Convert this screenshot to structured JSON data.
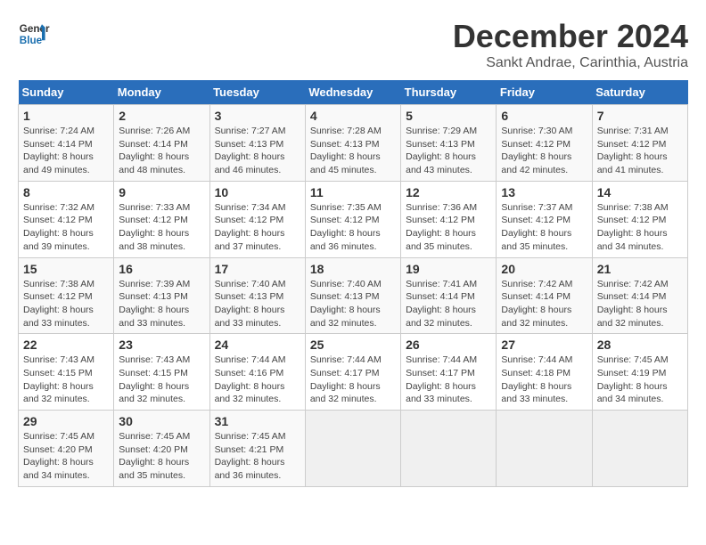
{
  "header": {
    "logo_line1": "General",
    "logo_line2": "Blue",
    "main_title": "December 2024",
    "subtitle": "Sankt Andrae, Carinthia, Austria"
  },
  "calendar": {
    "weekdays": [
      "Sunday",
      "Monday",
      "Tuesday",
      "Wednesday",
      "Thursday",
      "Friday",
      "Saturday"
    ],
    "weeks": [
      [
        {
          "day": "1",
          "sunrise": "7:24 AM",
          "sunset": "4:14 PM",
          "daylight": "8 hours and 49 minutes."
        },
        {
          "day": "2",
          "sunrise": "7:26 AM",
          "sunset": "4:14 PM",
          "daylight": "8 hours and 48 minutes."
        },
        {
          "day": "3",
          "sunrise": "7:27 AM",
          "sunset": "4:13 PM",
          "daylight": "8 hours and 46 minutes."
        },
        {
          "day": "4",
          "sunrise": "7:28 AM",
          "sunset": "4:13 PM",
          "daylight": "8 hours and 45 minutes."
        },
        {
          "day": "5",
          "sunrise": "7:29 AM",
          "sunset": "4:13 PM",
          "daylight": "8 hours and 43 minutes."
        },
        {
          "day": "6",
          "sunrise": "7:30 AM",
          "sunset": "4:12 PM",
          "daylight": "8 hours and 42 minutes."
        },
        {
          "day": "7",
          "sunrise": "7:31 AM",
          "sunset": "4:12 PM",
          "daylight": "8 hours and 41 minutes."
        }
      ],
      [
        {
          "day": "8",
          "sunrise": "7:32 AM",
          "sunset": "4:12 PM",
          "daylight": "8 hours and 39 minutes."
        },
        {
          "day": "9",
          "sunrise": "7:33 AM",
          "sunset": "4:12 PM",
          "daylight": "8 hours and 38 minutes."
        },
        {
          "day": "10",
          "sunrise": "7:34 AM",
          "sunset": "4:12 PM",
          "daylight": "8 hours and 37 minutes."
        },
        {
          "day": "11",
          "sunrise": "7:35 AM",
          "sunset": "4:12 PM",
          "daylight": "8 hours and 36 minutes."
        },
        {
          "day": "12",
          "sunrise": "7:36 AM",
          "sunset": "4:12 PM",
          "daylight": "8 hours and 35 minutes."
        },
        {
          "day": "13",
          "sunrise": "7:37 AM",
          "sunset": "4:12 PM",
          "daylight": "8 hours and 35 minutes."
        },
        {
          "day": "14",
          "sunrise": "7:38 AM",
          "sunset": "4:12 PM",
          "daylight": "8 hours and 34 minutes."
        }
      ],
      [
        {
          "day": "15",
          "sunrise": "7:38 AM",
          "sunset": "4:12 PM",
          "daylight": "8 hours and 33 minutes."
        },
        {
          "day": "16",
          "sunrise": "7:39 AM",
          "sunset": "4:13 PM",
          "daylight": "8 hours and 33 minutes."
        },
        {
          "day": "17",
          "sunrise": "7:40 AM",
          "sunset": "4:13 PM",
          "daylight": "8 hours and 33 minutes."
        },
        {
          "day": "18",
          "sunrise": "7:40 AM",
          "sunset": "4:13 PM",
          "daylight": "8 hours and 32 minutes."
        },
        {
          "day": "19",
          "sunrise": "7:41 AM",
          "sunset": "4:14 PM",
          "daylight": "8 hours and 32 minutes."
        },
        {
          "day": "20",
          "sunrise": "7:42 AM",
          "sunset": "4:14 PM",
          "daylight": "8 hours and 32 minutes."
        },
        {
          "day": "21",
          "sunrise": "7:42 AM",
          "sunset": "4:14 PM",
          "daylight": "8 hours and 32 minutes."
        }
      ],
      [
        {
          "day": "22",
          "sunrise": "7:43 AM",
          "sunset": "4:15 PM",
          "daylight": "8 hours and 32 minutes."
        },
        {
          "day": "23",
          "sunrise": "7:43 AM",
          "sunset": "4:15 PM",
          "daylight": "8 hours and 32 minutes."
        },
        {
          "day": "24",
          "sunrise": "7:44 AM",
          "sunset": "4:16 PM",
          "daylight": "8 hours and 32 minutes."
        },
        {
          "day": "25",
          "sunrise": "7:44 AM",
          "sunset": "4:17 PM",
          "daylight": "8 hours and 32 minutes."
        },
        {
          "day": "26",
          "sunrise": "7:44 AM",
          "sunset": "4:17 PM",
          "daylight": "8 hours and 33 minutes."
        },
        {
          "day": "27",
          "sunrise": "7:44 AM",
          "sunset": "4:18 PM",
          "daylight": "8 hours and 33 minutes."
        },
        {
          "day": "28",
          "sunrise": "7:45 AM",
          "sunset": "4:19 PM",
          "daylight": "8 hours and 34 minutes."
        }
      ],
      [
        {
          "day": "29",
          "sunrise": "7:45 AM",
          "sunset": "4:20 PM",
          "daylight": "8 hours and 34 minutes."
        },
        {
          "day": "30",
          "sunrise": "7:45 AM",
          "sunset": "4:20 PM",
          "daylight": "8 hours and 35 minutes."
        },
        {
          "day": "31",
          "sunrise": "7:45 AM",
          "sunset": "4:21 PM",
          "daylight": "8 hours and 36 minutes."
        },
        null,
        null,
        null,
        null
      ]
    ]
  }
}
